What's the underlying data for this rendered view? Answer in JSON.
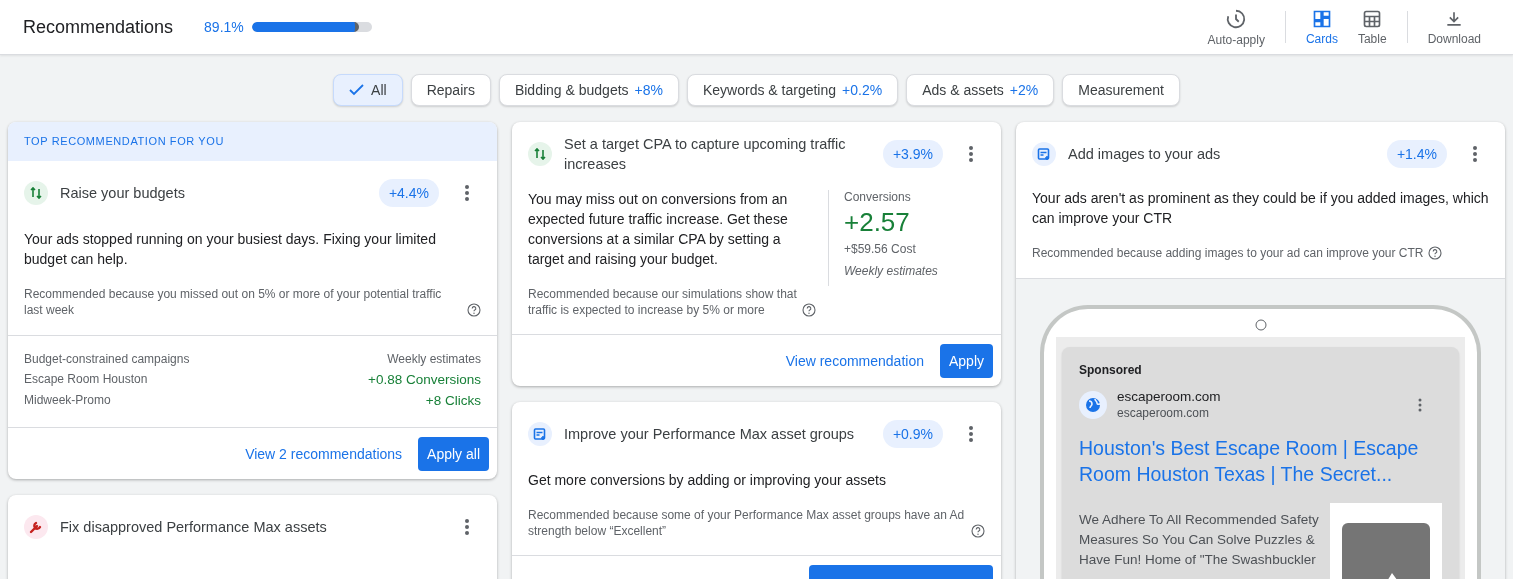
{
  "header": {
    "title": "Recommendations",
    "progress": {
      "text": "89.1%",
      "level": 0.891
    },
    "actions": [
      {
        "kind": "auto",
        "label": "Auto-apply",
        "selected": false
      },
      {
        "kind": "cards",
        "label": "Cards",
        "selected": true
      },
      {
        "kind": "table",
        "label": "Table",
        "selected": false
      },
      {
        "kind": "download",
        "label": "Download",
        "selected": false
      }
    ]
  },
  "filters": [
    {
      "label": "All",
      "selected": true
    },
    {
      "label": "Repairs",
      "selected": false
    },
    {
      "label": "Bidding & budgets",
      "delta": "+8%",
      "selected": false
    },
    {
      "label": "Keywords & targeting",
      "delta": "+0.2%",
      "selected": false
    },
    {
      "label": "Ads & assets",
      "delta": "+2%",
      "selected": false
    },
    {
      "label": "Measurement",
      "selected": false
    }
  ],
  "columns": [
    [
      {
        "kind": "campaigns",
        "banner": "TOP RECOMMENDATION FOR YOU",
        "icon": {
          "kind": "bidding"
        },
        "title": "Raise your budgets",
        "impact": "+4.4%",
        "description": "Your ads stopped running on your busiest days. Fixing your limited budget can help.",
        "reason": "Recommended because you missed out on 5% or more of your potential traffic last week",
        "campaigns": {
          "heading": "Budget-constrained campaigns",
          "estimates_label": "Weekly estimates",
          "names": [
            "Escape Room Houston",
            "Midweek-Promo"
          ],
          "values": [
            "+0.88 Conversions",
            "+8 Clicks"
          ]
        },
        "link": "View 2 recommendations",
        "button": "Apply all"
      },
      {
        "kind": "basic",
        "icon": {
          "kind": "repairs"
        },
        "title": "Fix disapproved Performance Max assets"
      }
    ],
    [
      {
        "kind": "estimate",
        "icon": {
          "kind": "bidding"
        },
        "title": "Set a target CPA to capture upcoming traffic increases",
        "impact": "+3.9%",
        "description": "You may miss out on conversions from an expected future traffic increase. Get these conversions at a similar CPA by setting a target and raising your budget.",
        "reason": "Recommended because our simulations show that traffic is expected to increase by 5% or more",
        "estimate": {
          "label": "Conversions",
          "value": "+2.57",
          "cost": "+$59.56 Cost",
          "note": "Weekly estimates"
        },
        "link": "View recommendation",
        "button": "Apply"
      },
      {
        "kind": "basic",
        "icon": {
          "kind": "ads"
        },
        "title": "Improve your Performance Max asset groups",
        "impact": "+0.9%",
        "description": "Get more conversions by adding or improving your assets",
        "reason": "Recommended because some of your Performance Max asset groups have an Ad strength below “Excellent”",
        "footer": true
      }
    ],
    [
      {
        "kind": "preview",
        "icon": {
          "kind": "ads"
        },
        "title": "Add images to your ads",
        "impact": "+1.4%",
        "description": "Your ads aren't as prominent as they could be if you added images, which can improve your CTR",
        "reason": "Recommended because adding images to your ad can improve your CTR",
        "preview": {
          "label": "Sponsored",
          "site": "escaperoom.com",
          "url": "escaperoom.com",
          "headline": "Houston's Best Escape Room | Escape Room Houston Texas | The Secret...",
          "body": "We Adhere To All Recommended Safety Measures So You Can Solve Puzzles & Have Fun! Home of \"The Swashbuckler"
        }
      }
    ]
  ]
}
